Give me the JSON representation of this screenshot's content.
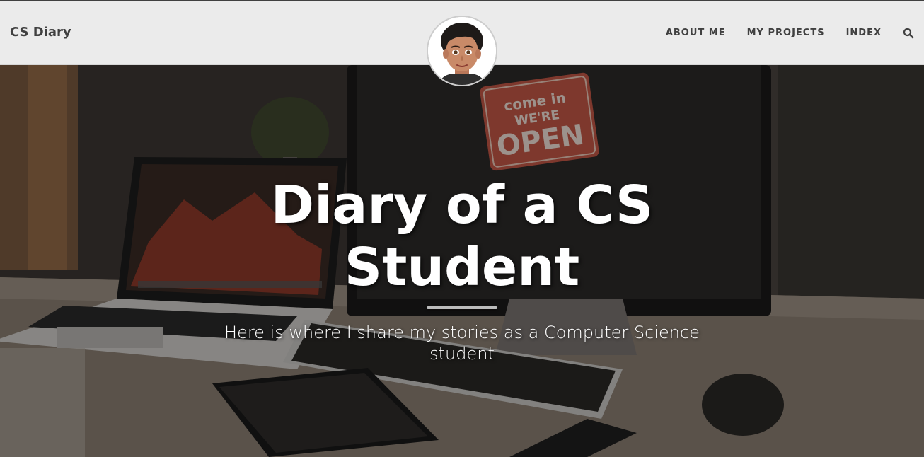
{
  "navbar": {
    "brand": "CS Diary",
    "links": [
      "ABOUT ME",
      "MY PROJECTS",
      "INDEX"
    ],
    "search_icon": "search-icon",
    "avatar": "avatar-icon"
  },
  "hero": {
    "heading_line1": "Diary of a CS",
    "heading_line2": "Student",
    "subheading": "Here is where I share my stories as a Computer Science student",
    "background": {
      "sign_line1": "come in",
      "sign_line2": "WE'RE",
      "sign_line3": "OPEN"
    }
  },
  "colors": {
    "navbar_bg": "#ebebeb",
    "nav_text": "#404040",
    "hero_text": "#ffffff"
  }
}
